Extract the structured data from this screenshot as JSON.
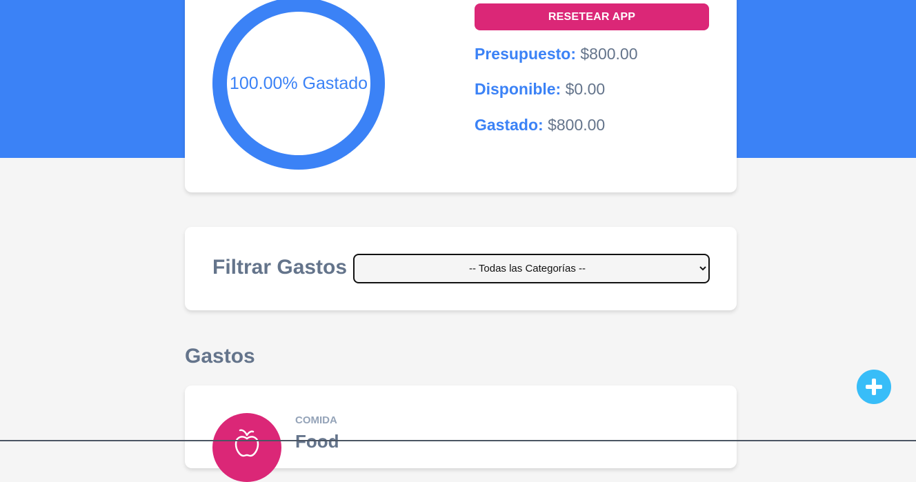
{
  "colors": {
    "primary": "#3b82f6",
    "accent": "#db2777",
    "add_button": "#38bdf8",
    "background": "#f5f5f5"
  },
  "budget": {
    "progress_percent": 100,
    "progress_label": "100.00% Gastado",
    "reset_label": "RESETEAR APP",
    "stats": {
      "presupuesto_label": "Presupuesto:",
      "presupuesto_value": "$800.00",
      "disponible_label": "Disponible:",
      "disponible_value": "$0.00",
      "gastado_label": "Gastado:",
      "gastado_value": "$800.00"
    }
  },
  "filter": {
    "title": "Filtrar Gastos",
    "selected_option": "-- Todas las Categorías --"
  },
  "expenses": {
    "section_title": "Gastos",
    "items": [
      {
        "category": "COMIDA",
        "name": "Food",
        "icon": "apple-icon"
      }
    ]
  },
  "add_button_icon": "plus-icon"
}
